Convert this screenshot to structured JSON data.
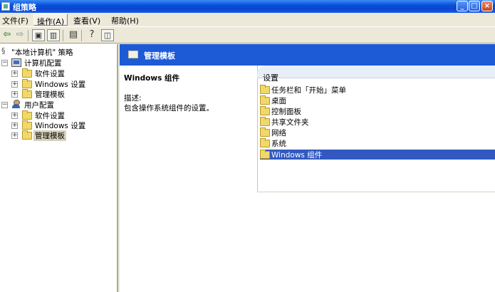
{
  "window": {
    "title": "组策略"
  },
  "menu": [
    "文件(F)",
    "操作(A)",
    "查看(V)",
    "帮助(H)"
  ],
  "title_controls": {
    "minimize": "_",
    "maximize": "□",
    "close": "×"
  },
  "toolbar_icons": [
    "back-arrow",
    "forward-arrow",
    "up-folder",
    "show-hide-tree",
    "properties",
    "help",
    "export-list"
  ],
  "tree": {
    "root": "\"本地计算机\" 策略",
    "computer": {
      "label": "计算机配置",
      "children": [
        "软件设置",
        "Windows 设置",
        "管理模板"
      ]
    },
    "user": {
      "label": "用户配置",
      "children": [
        "软件设置",
        "Windows 设置",
        "管理模板"
      ]
    },
    "expander": "+",
    "collapser": "−"
  },
  "right": {
    "header": "管理模板",
    "desc_title": "Windows 组件",
    "desc_label": "描述:",
    "desc_text": "包含操作系统组件的设置。",
    "settings_header": "设置",
    "settings": [
      "任务栏和「开始」菜单",
      "桌面",
      "控制面板",
      "共享文件夹",
      "网络",
      "系统",
      "Windows 组件"
    ],
    "selected_setting": "Windows 组件"
  },
  "colors": {
    "title_bar": "#0a46d0",
    "header_band": "#1c5ad6",
    "selection": "#3159c0"
  }
}
